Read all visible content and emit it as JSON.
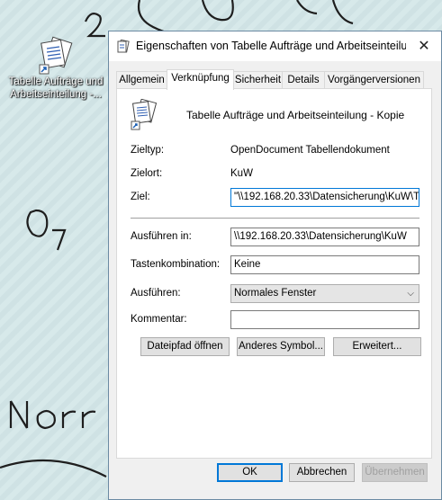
{
  "desktop": {
    "icon_label_line1": "Tabelle Aufträge und",
    "icon_label_line2": "Arbeitseinteilung -..."
  },
  "dialog": {
    "title": "Eigenschaften von Tabelle Aufträge und Arbeitseinteilu...",
    "tabs": [
      {
        "label": "Allgemein"
      },
      {
        "label": "Verknüpfung"
      },
      {
        "label": "Sicherheit"
      },
      {
        "label": "Details"
      },
      {
        "label": "Vorgängerversionen"
      }
    ],
    "active_tab": "Verknüpfung",
    "shortcut_name": "Tabelle Aufträge und Arbeitseinteilung - Kopie",
    "fields": {
      "target_type_label": "Zieltyp:",
      "target_type_value": "OpenDocument Tabellendokument",
      "target_location_label": "Zielort:",
      "target_location_value": "KuW",
      "target_label": "Ziel:",
      "target_value": "\"\\\\192.168.20.33\\Datensicherung\\KuW\\T",
      "start_in_label": "Ausführen in:",
      "start_in_value": "\\\\192.168.20.33\\Datensicherung\\KuW",
      "shortcut_key_label": "Tastenkombination:",
      "shortcut_key_value": "Keine",
      "run_label": "Ausführen:",
      "run_value": "Normales Fenster",
      "comment_label": "Kommentar:",
      "comment_value": ""
    },
    "buttons": {
      "open_path": "Dateipfad öffnen",
      "change_icon": "Anderes Symbol...",
      "advanced": "Erweitert...",
      "ok": "OK",
      "cancel": "Abbrechen",
      "apply": "Übernehmen"
    }
  }
}
